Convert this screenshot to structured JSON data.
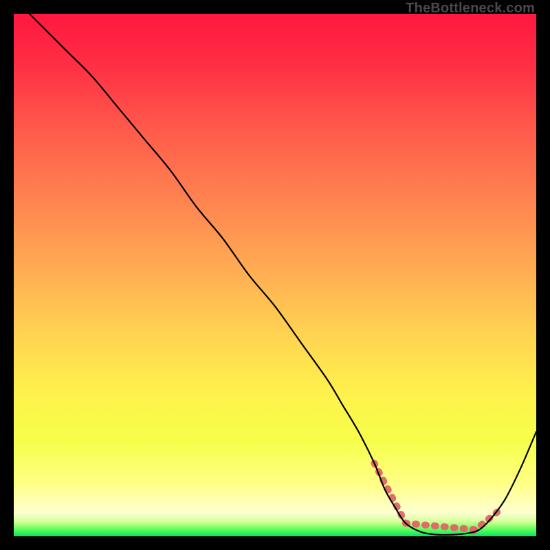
{
  "attribution": "TheBottleneck.com",
  "chart_data": {
    "type": "line",
    "title": "",
    "xlabel": "",
    "ylabel": "",
    "xlim": [
      0,
      100
    ],
    "ylim": [
      0,
      100
    ],
    "curve": {
      "x": [
        3,
        6,
        10,
        15,
        20,
        25,
        30,
        35,
        40,
        45,
        50,
        55,
        60,
        63,
        66,
        69,
        71,
        73,
        75,
        78,
        81,
        84,
        87,
        89,
        91,
        94,
        97,
        100
      ],
      "y": [
        100,
        97,
        93,
        88,
        82,
        76,
        70,
        63,
        57,
        50,
        44,
        37,
        30,
        25,
        20,
        14,
        9,
        5.5,
        2.5,
        0.8,
        0.3,
        0.3,
        0.6,
        1.2,
        3,
        7,
        13,
        20
      ]
    },
    "outlier_band": {
      "segments": [
        {
          "x": [
            69,
            75
          ],
          "y": [
            14,
            2.5
          ]
        },
        {
          "x": [
            75,
            89
          ],
          "y": [
            2.5,
            1.2
          ]
        },
        {
          "x": [
            88,
            93
          ],
          "y": [
            1.0,
            5.0
          ]
        }
      ],
      "color": "#e06666"
    },
    "gradient_stops": [
      {
        "offset": 0.0,
        "color": "#ff173f"
      },
      {
        "offset": 0.1,
        "color": "#ff2f44"
      },
      {
        "offset": 0.22,
        "color": "#ff5a4b"
      },
      {
        "offset": 0.35,
        "color": "#ff8150"
      },
      {
        "offset": 0.48,
        "color": "#ffa953"
      },
      {
        "offset": 0.6,
        "color": "#ffcf52"
      },
      {
        "offset": 0.72,
        "color": "#fff04c"
      },
      {
        "offset": 0.82,
        "color": "#f6ff4a"
      },
      {
        "offset": 0.9,
        "color": "#ffff87"
      },
      {
        "offset": 0.935,
        "color": "#ffffb5"
      },
      {
        "offset": 0.955,
        "color": "#fcffd0"
      },
      {
        "offset": 0.972,
        "color": "#d4ff9a"
      },
      {
        "offset": 0.985,
        "color": "#6fff5e"
      },
      {
        "offset": 1.0,
        "color": "#00e861"
      }
    ]
  }
}
